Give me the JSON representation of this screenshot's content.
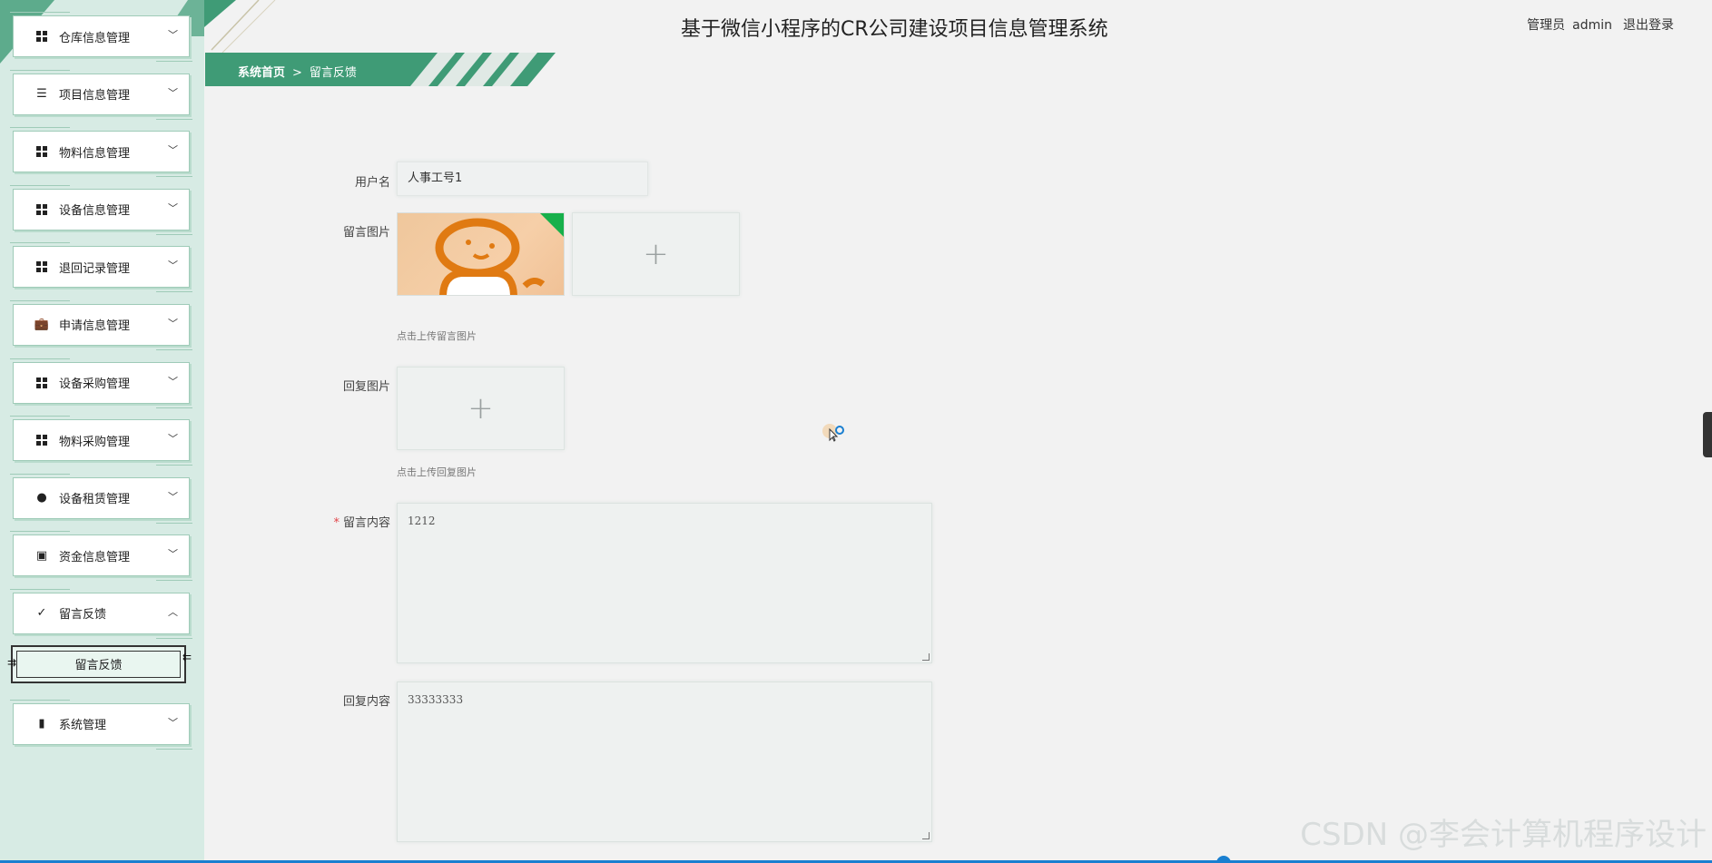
{
  "header": {
    "title": "基于微信小程序的CR公司建设项目信息管理系统",
    "user_role": "管理员",
    "user_name": "admin",
    "logout": "退出登录"
  },
  "breadcrumb": {
    "home": "系统首页",
    "separator": ">",
    "current": "留言反馈"
  },
  "sidebar": {
    "items": [
      {
        "label": "仓库信息管理",
        "icon": "grid-icon",
        "expanded": false
      },
      {
        "label": "项目信息管理",
        "icon": "list-icon",
        "expanded": false
      },
      {
        "label": "物料信息管理",
        "icon": "grid-icon",
        "expanded": false
      },
      {
        "label": "设备信息管理",
        "icon": "grid-icon",
        "expanded": false
      },
      {
        "label": "退回记录管理",
        "icon": "grid-icon",
        "expanded": false
      },
      {
        "label": "申请信息管理",
        "icon": "briefcase-icon",
        "expanded": false
      },
      {
        "label": "设备采购管理",
        "icon": "grid-icon",
        "expanded": false
      },
      {
        "label": "物料采购管理",
        "icon": "grid-icon",
        "expanded": false
      },
      {
        "label": "设备租赁管理",
        "icon": "bulb-icon",
        "expanded": false
      },
      {
        "label": "资金信息管理",
        "icon": "ticket-icon",
        "expanded": false
      },
      {
        "label": "留言反馈",
        "icon": "clipboard-check-icon",
        "expanded": true
      },
      {
        "label": "系统管理",
        "icon": "book-icon",
        "expanded": false
      }
    ],
    "sub_item": "留言反馈"
  },
  "form": {
    "username_label": "用户名",
    "username_value": "人事工号1",
    "msg_image_label": "留言图片",
    "msg_image_hint": "点击上传留言图片",
    "reply_image_label": "回复图片",
    "reply_image_hint": "点击上传回复图片",
    "msg_content_required": "*",
    "msg_content_label": "留言内容",
    "msg_content_value": "1212",
    "reply_content_label": "回复内容",
    "reply_content_value": "33333333",
    "plus": "+"
  },
  "watermark": "CSDN @李会计算机程序设计",
  "colors": {
    "accent": "#3f9b76",
    "sidebar_bg": "#d7ebe4",
    "page_bg": "#f2f2f2",
    "required": "#e2454a"
  }
}
